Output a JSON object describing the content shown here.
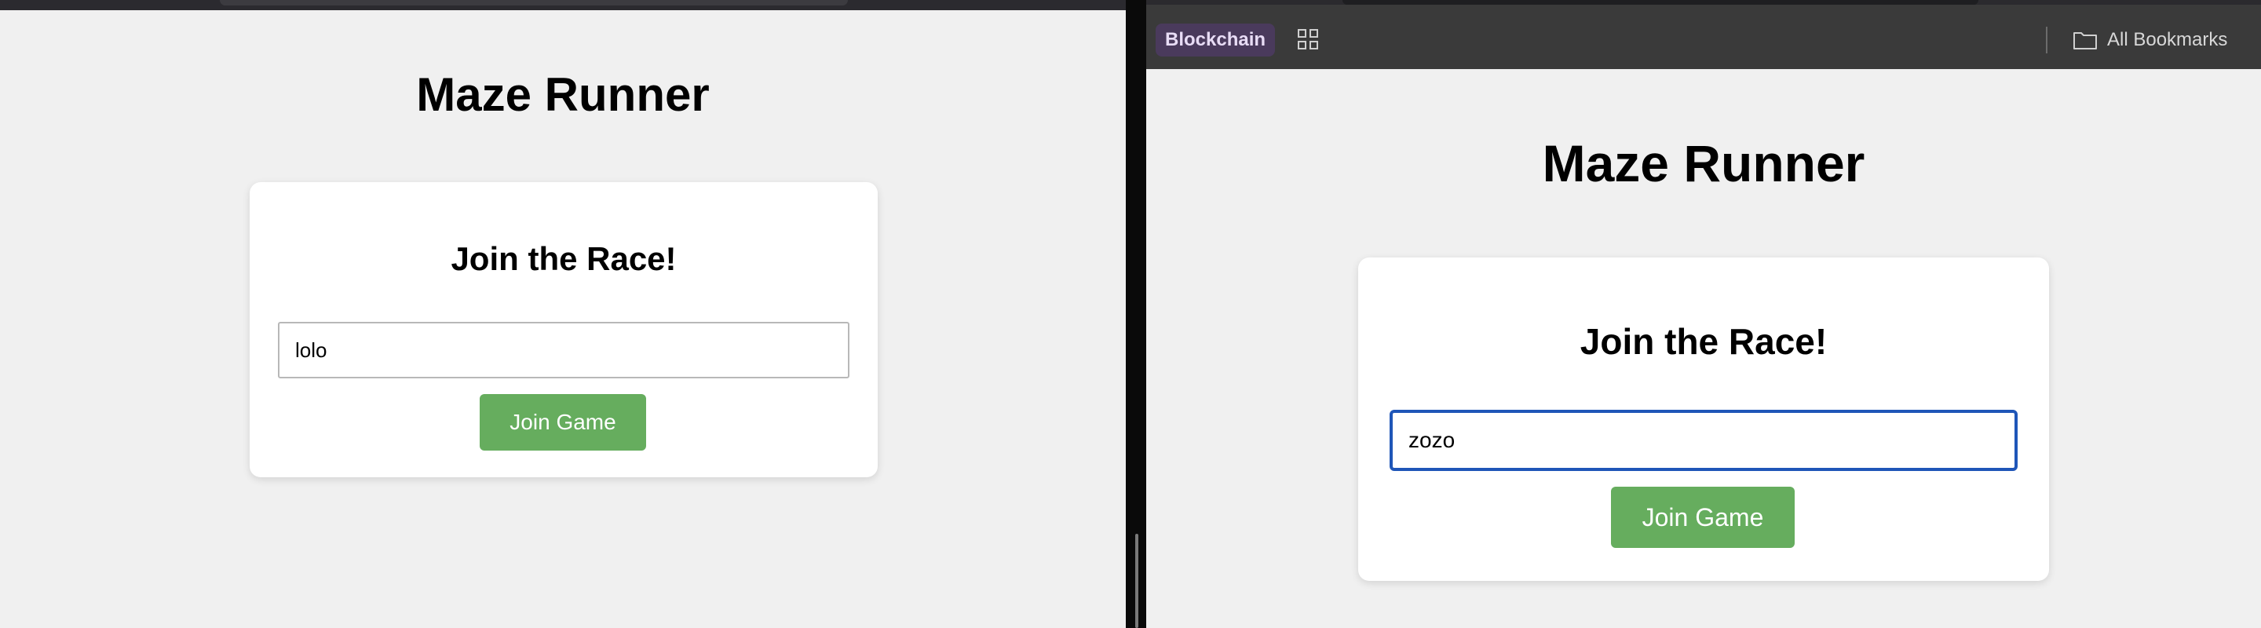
{
  "left": {
    "app_title": "Maze Runner",
    "card_title": "Join the Race!",
    "name_input_value": "lolo",
    "join_button_label": "Join Game"
  },
  "right": {
    "bookmarks": {
      "chip_label": "Blockchain",
      "apps_icon": "grid-icon",
      "all_bookmarks_label": "All Bookmarks",
      "folder_icon": "folder-icon"
    },
    "app_title": "Maze Runner",
    "card_title": "Join the Race!",
    "name_input_value": "zozo",
    "join_button_label": "Join Game"
  },
  "colors": {
    "button_green": "#66ad5e",
    "focus_blue": "#1f56b8",
    "page_bg": "#f0f0f0",
    "chip_bg": "#4a3a5c"
  }
}
